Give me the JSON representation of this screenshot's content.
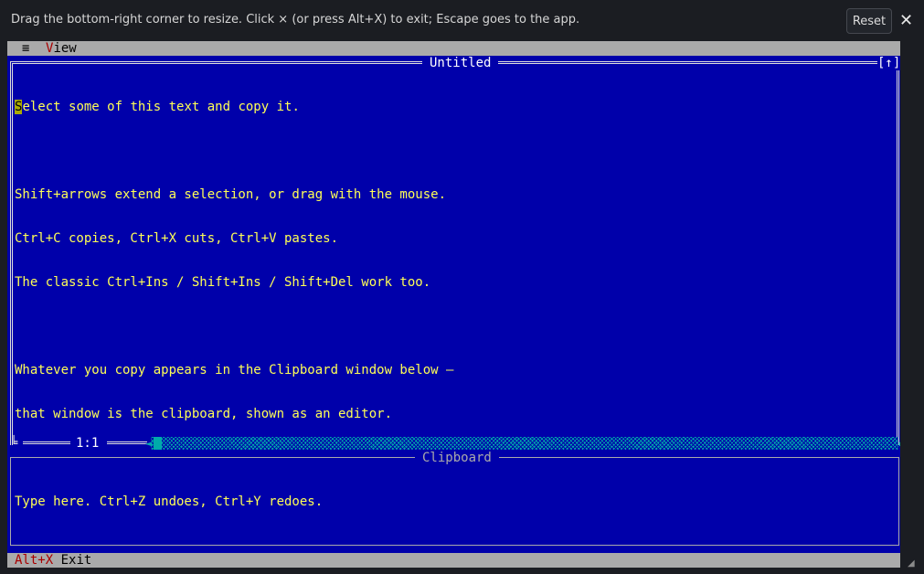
{
  "topbar": {
    "hint": "Drag the bottom-right corner to resize. Click × (or press Alt+X) to exit; Escape goes to the app.",
    "reset_label": "Reset",
    "close_glyph": "✕"
  },
  "menubar": {
    "system_menu_glyph": "≡",
    "items": [
      {
        "hotkey": "V",
        "rest": "iew"
      }
    ]
  },
  "editor": {
    "title": "Untitled",
    "zoom_glyph": "[↑]",
    "cursor_char": "S",
    "lines": [
      "elect some of this text and copy it.",
      "",
      "Shift+arrows extend a selection, or drag with the mouse.",
      "Ctrl+C copies, Ctrl+X cuts, Ctrl+V pastes.",
      "The classic Ctrl+Ins / Shift+Ins / Shift+Del work too.",
      "",
      "Whatever you copy appears in the Clipboard window below —",
      "that window is the clipboard, shown as an editor.",
      "",
      "Type here. Ctrl+Z undoes, Ctrl+Y redoes."
    ],
    "position": "1:1",
    "corner_glyph": "╘"
  },
  "clipboard": {
    "title": "Clipboard"
  },
  "statusbar": {
    "exit_key": "Alt+X",
    "exit_label": "Exit"
  },
  "colors": {
    "desktop_blue": "#0000aa",
    "editor_text": "#ffff55",
    "menu_gray": "#aaaaaa",
    "hotkey_red": "#aa0000",
    "scrollbar_cyan": "#00aaaa"
  }
}
